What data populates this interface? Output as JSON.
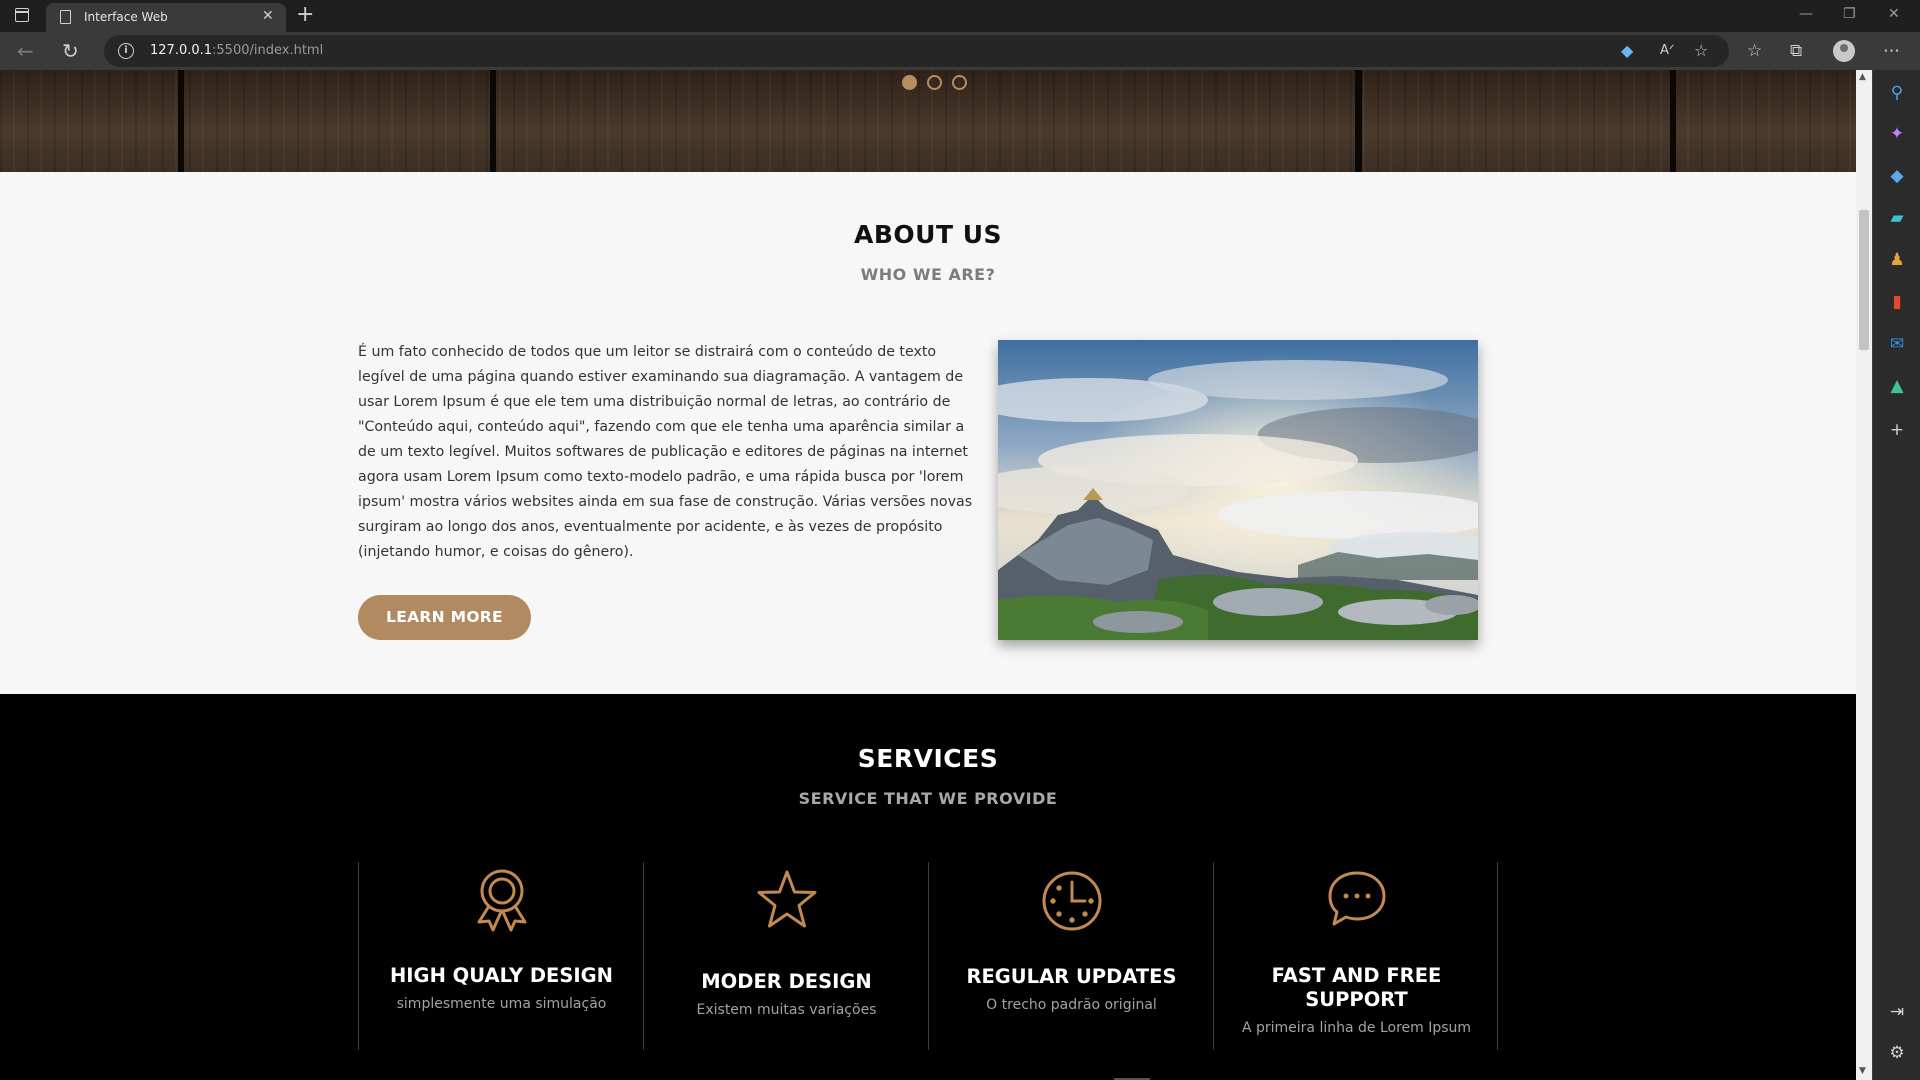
{
  "browser": {
    "tab_title": "Interface Web",
    "url_host": "127.0.0.1",
    "url_rest": ":5500/index.html"
  },
  "hero": {
    "slides_total": 3,
    "active_slide": 1
  },
  "about": {
    "title": "ABOUT US",
    "subtitle": "WHO WE ARE?",
    "body": "É um fato conhecido de todos que um leitor se distrairá com o conteúdo de texto legível de uma página quando estiver examinando sua diagramação. A vantagem de usar Lorem Ipsum é que ele tem uma distribuição normal de letras, ao contrário de \"Conteúdo aqui, conteúdo aqui\", fazendo com que ele tenha uma aparência similar a de um texto legível. Muitos softwares de publicação e editores de páginas na internet agora usam Lorem Ipsum como texto-modelo padrão, e uma rápida busca por 'lorem ipsum' mostra vários websites ainda em sua fase de construção. Várias versões novas surgiram ao longo dos anos, eventualmente por acidente, e às vezes de propósito (injetando humor, e coisas do gênero).",
    "button_label": "LEARN MORE"
  },
  "services": {
    "title": "SERVICES",
    "subtitle": "SERVICE THAT WE PROVIDE",
    "items": [
      {
        "icon": "award-ribbon-icon",
        "name": "HIGH QUALY DESIGN",
        "desc": "simplesmente uma simulação"
      },
      {
        "icon": "star-icon",
        "name": "MODER DESIGN",
        "desc": "Existem muitas variações"
      },
      {
        "icon": "clock-icon",
        "name": "REGULAR UPDATES",
        "desc": "O trecho padrão original"
      },
      {
        "icon": "chat-bubble-icon",
        "name": "FAST AND FREE SUPPORT",
        "desc": "A primeira linha de Lorem Ipsum"
      }
    ]
  },
  "colors": {
    "accent": "#b28a62",
    "services_bg": "#010101",
    "about_bg": "#f7f7f7"
  }
}
